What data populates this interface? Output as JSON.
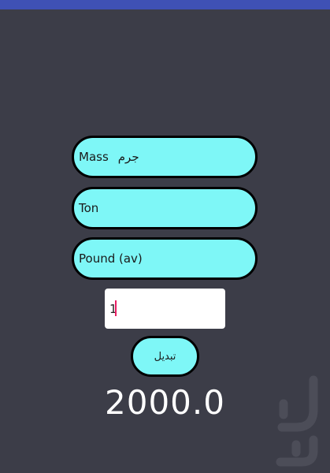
{
  "category_spinner": {
    "label_en": "Mass",
    "label_fa": "جرم"
  },
  "from_unit_spinner": {
    "label": "Ton"
  },
  "to_unit_spinner": {
    "label": "Pound (av)"
  },
  "value_input": {
    "value": "1"
  },
  "convert_button": {
    "label": "تبدیل"
  },
  "result": {
    "value": "2000.0"
  },
  "colors": {
    "background": "#3c3d48",
    "status_bar": "#3f51b5",
    "pill_fill": "#7ef7f7",
    "pill_border": "#000000",
    "caret": "#e91e63",
    "result_text": "#ffffff"
  }
}
